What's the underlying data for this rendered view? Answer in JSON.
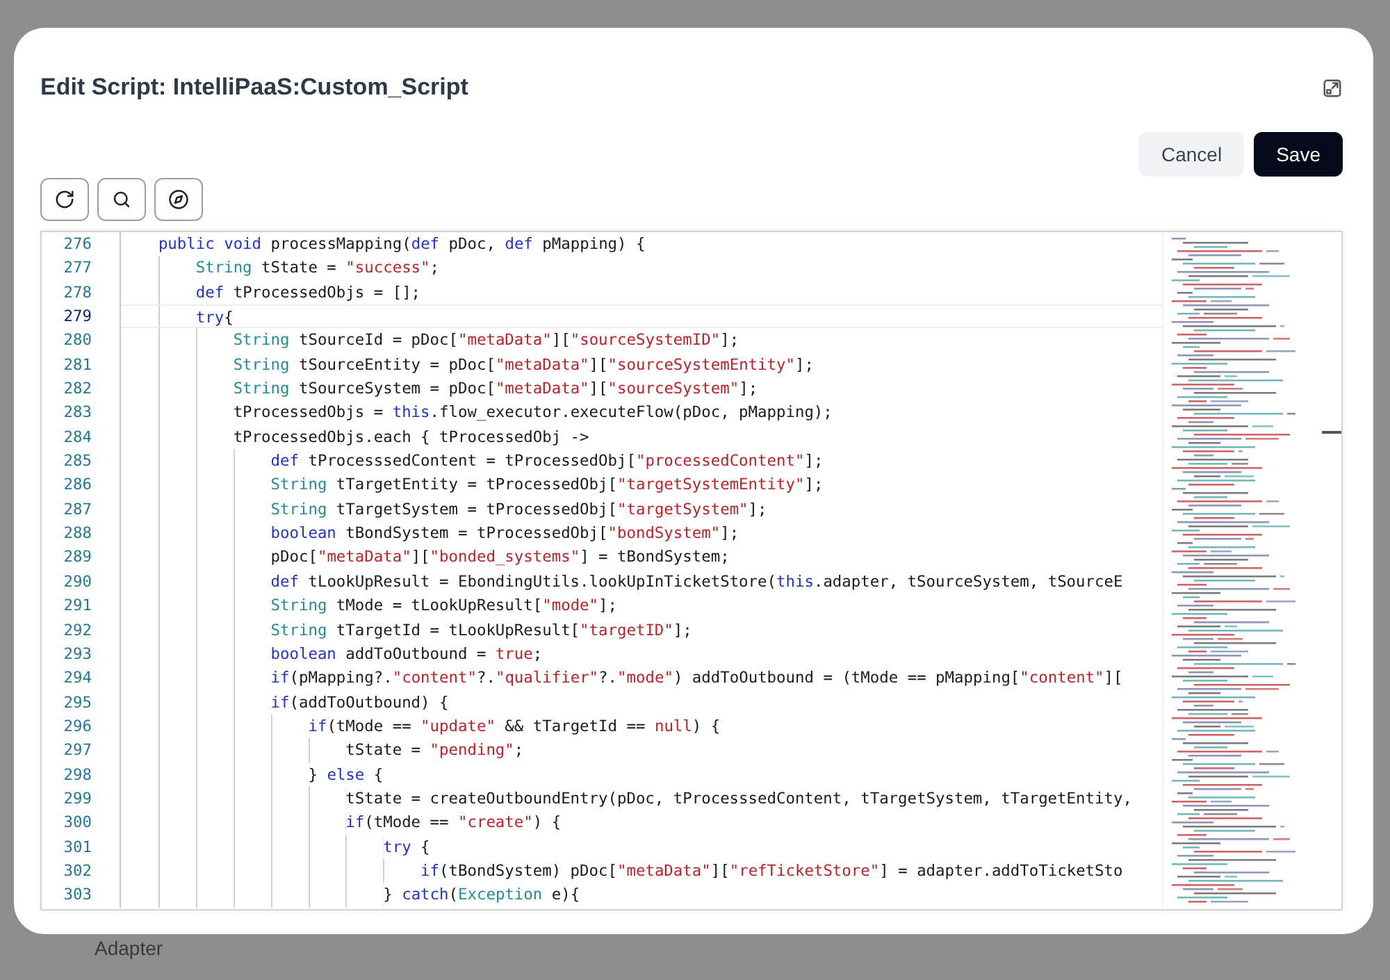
{
  "background": {
    "label": "Adapter"
  },
  "dialog": {
    "title": "Edit Script: IntelliPaaS:Custom_Script",
    "actions": [
      {
        "label": "Cancel",
        "kind": "secondary"
      },
      {
        "label": "Save",
        "kind": "primary"
      }
    ],
    "tools": [
      {
        "kind": "refresh"
      },
      {
        "kind": "search"
      },
      {
        "kind": "compass"
      }
    ],
    "editor": {
      "lines": [
        {
          "number": "276",
          "current": false,
          "segments": [
            {
              "kind": "keyword",
              "text": "    public void"
            },
            {
              "kind": "plain",
              "text": " processMapping("
            },
            {
              "kind": "keyword",
              "text": "def"
            },
            {
              "kind": "plain",
              "text": " pDoc, "
            },
            {
              "kind": "keyword",
              "text": "def"
            },
            {
              "kind": "plain",
              "text": " pMapping) {"
            }
          ]
        },
        {
          "number": "277",
          "current": false,
          "segments": [
            {
              "kind": "type",
              "text": "        String"
            },
            {
              "kind": "plain",
              "text": " tState = "
            },
            {
              "kind": "string",
              "text": "\"success\""
            },
            {
              "kind": "plain",
              "text": ";"
            }
          ]
        },
        {
          "number": "278",
          "current": false,
          "segments": [
            {
              "kind": "keyword",
              "text": "        def"
            },
            {
              "kind": "plain",
              "text": " tProcessedObjs = [];"
            }
          ]
        },
        {
          "number": "279",
          "current": true,
          "segments": [
            {
              "kind": "keyword",
              "text": "        try"
            },
            {
              "kind": "plain",
              "text": "{"
            }
          ]
        },
        {
          "number": "280",
          "current": false,
          "segments": [
            {
              "kind": "type",
              "text": "            String"
            },
            {
              "kind": "plain",
              "text": " tSourceId = pDoc["
            },
            {
              "kind": "string",
              "text": "\"metaData\""
            },
            {
              "kind": "plain",
              "text": "]["
            },
            {
              "kind": "string",
              "text": "\"sourceSystemID\""
            },
            {
              "kind": "plain",
              "text": "];"
            }
          ]
        },
        {
          "number": "281",
          "current": false,
          "segments": [
            {
              "kind": "type",
              "text": "            String"
            },
            {
              "kind": "plain",
              "text": " tSourceEntity = pDoc["
            },
            {
              "kind": "string",
              "text": "\"metaData\""
            },
            {
              "kind": "plain",
              "text": "]["
            },
            {
              "kind": "string",
              "text": "\"sourceSystemEntity\""
            },
            {
              "kind": "plain",
              "text": "];"
            }
          ]
        },
        {
          "number": "282",
          "current": false,
          "segments": [
            {
              "kind": "type",
              "text": "            String"
            },
            {
              "kind": "plain",
              "text": " tSourceSystem = pDoc["
            },
            {
              "kind": "string",
              "text": "\"metaData\""
            },
            {
              "kind": "plain",
              "text": "]["
            },
            {
              "kind": "string",
              "text": "\"sourceSystem\""
            },
            {
              "kind": "plain",
              "text": "];"
            }
          ]
        },
        {
          "number": "283",
          "current": false,
          "segments": [
            {
              "kind": "plain",
              "text": "            tProcessedObjs = "
            },
            {
              "kind": "keyword",
              "text": "this"
            },
            {
              "kind": "plain",
              "text": ".flow_executor.executeFlow(pDoc, pMapping);"
            }
          ]
        },
        {
          "number": "284",
          "current": false,
          "segments": [
            {
              "kind": "plain",
              "text": "            tProcessedObjs.each { tProcessedObj ->"
            }
          ]
        },
        {
          "number": "285",
          "current": false,
          "segments": [
            {
              "kind": "keyword",
              "text": "                def"
            },
            {
              "kind": "plain",
              "text": " tProcesssedContent = tProcessedObj["
            },
            {
              "kind": "string",
              "text": "\"processedContent\""
            },
            {
              "kind": "plain",
              "text": "];"
            }
          ]
        },
        {
          "number": "286",
          "current": false,
          "segments": [
            {
              "kind": "type",
              "text": "                String"
            },
            {
              "kind": "plain",
              "text": " tTargetEntity = tProcessedObj["
            },
            {
              "kind": "string",
              "text": "\"targetSystemEntity\""
            },
            {
              "kind": "plain",
              "text": "];"
            }
          ]
        },
        {
          "number": "287",
          "current": false,
          "segments": [
            {
              "kind": "type",
              "text": "                String"
            },
            {
              "kind": "plain",
              "text": " tTargetSystem = tProcessedObj["
            },
            {
              "kind": "string",
              "text": "\"targetSystem\""
            },
            {
              "kind": "plain",
              "text": "];"
            }
          ]
        },
        {
          "number": "288",
          "current": false,
          "segments": [
            {
              "kind": "keyword",
              "text": "                boolean"
            },
            {
              "kind": "plain",
              "text": " tBondSystem = tProcessedObj["
            },
            {
              "kind": "string",
              "text": "\"bondSystem\""
            },
            {
              "kind": "plain",
              "text": "];"
            }
          ]
        },
        {
          "number": "289",
          "current": false,
          "segments": [
            {
              "kind": "plain",
              "text": "                pDoc["
            },
            {
              "kind": "string",
              "text": "\"metaData\""
            },
            {
              "kind": "plain",
              "text": "]["
            },
            {
              "kind": "string",
              "text": "\"bonded_systems\""
            },
            {
              "kind": "plain",
              "text": "] = tBondSystem;"
            }
          ]
        },
        {
          "number": "290",
          "current": false,
          "segments": [
            {
              "kind": "keyword",
              "text": "                def"
            },
            {
              "kind": "plain",
              "text": " tLookUpResult = EbondingUtils.lookUpInTicketStore("
            },
            {
              "kind": "keyword",
              "text": "this"
            },
            {
              "kind": "plain",
              "text": ".adapter, tSourceSystem, tSourceE"
            }
          ]
        },
        {
          "number": "291",
          "current": false,
          "segments": [
            {
              "kind": "type",
              "text": "                String"
            },
            {
              "kind": "plain",
              "text": " tMode = tLookUpResult["
            },
            {
              "kind": "string",
              "text": "\"mode\""
            },
            {
              "kind": "plain",
              "text": "];"
            }
          ]
        },
        {
          "number": "292",
          "current": false,
          "segments": [
            {
              "kind": "type",
              "text": "                String"
            },
            {
              "kind": "plain",
              "text": " tTargetId = tLookUpResult["
            },
            {
              "kind": "string",
              "text": "\"targetID\""
            },
            {
              "kind": "plain",
              "text": "];"
            }
          ]
        },
        {
          "number": "293",
          "current": false,
          "segments": [
            {
              "kind": "keyword",
              "text": "                boolean"
            },
            {
              "kind": "plain",
              "text": " addToOutbound = "
            },
            {
              "kind": "string",
              "text": "true"
            },
            {
              "kind": "plain",
              "text": ";"
            }
          ]
        },
        {
          "number": "294",
          "current": false,
          "segments": [
            {
              "kind": "keyword",
              "text": "                if"
            },
            {
              "kind": "plain",
              "text": "(pMapping?."
            },
            {
              "kind": "string",
              "text": "\"content\""
            },
            {
              "kind": "plain",
              "text": "?."
            },
            {
              "kind": "string",
              "text": "\"qualifier\""
            },
            {
              "kind": "plain",
              "text": "?."
            },
            {
              "kind": "string",
              "text": "\"mode\""
            },
            {
              "kind": "plain",
              "text": ") addToOutbound = (tMode == pMapping["
            },
            {
              "kind": "string",
              "text": "\"content\""
            },
            {
              "kind": "plain",
              "text": "]["
            }
          ]
        },
        {
          "number": "295",
          "current": false,
          "segments": [
            {
              "kind": "keyword",
              "text": "                if"
            },
            {
              "kind": "plain",
              "text": "(addToOutbound) {"
            }
          ]
        },
        {
          "number": "296",
          "current": false,
          "segments": [
            {
              "kind": "keyword",
              "text": "                    if"
            },
            {
              "kind": "plain",
              "text": "(tMode == "
            },
            {
              "kind": "string",
              "text": "\"update\""
            },
            {
              "kind": "plain",
              "text": " && tTargetId == "
            },
            {
              "kind": "string",
              "text": "null"
            },
            {
              "kind": "plain",
              "text": ") {"
            }
          ]
        },
        {
          "number": "297",
          "current": false,
          "segments": [
            {
              "kind": "plain",
              "text": "                        tState = "
            },
            {
              "kind": "string",
              "text": "\"pending\""
            },
            {
              "kind": "plain",
              "text": ";"
            }
          ]
        },
        {
          "number": "298",
          "current": false,
          "segments": [
            {
              "kind": "plain",
              "text": "                    } "
            },
            {
              "kind": "keyword",
              "text": "else"
            },
            {
              "kind": "plain",
              "text": " {"
            }
          ]
        },
        {
          "number": "299",
          "current": false,
          "segments": [
            {
              "kind": "plain",
              "text": "                        tState = createOutboundEntry(pDoc, tProcesssedContent, tTargetSystem, tTargetEntity,"
            }
          ]
        },
        {
          "number": "300",
          "current": false,
          "segments": [
            {
              "kind": "keyword",
              "text": "                        if"
            },
            {
              "kind": "plain",
              "text": "(tMode == "
            },
            {
              "kind": "string",
              "text": "\"create\""
            },
            {
              "kind": "plain",
              "text": ") {"
            }
          ]
        },
        {
          "number": "301",
          "current": false,
          "segments": [
            {
              "kind": "keyword",
              "text": "                            try"
            },
            {
              "kind": "plain",
              "text": " {"
            }
          ]
        },
        {
          "number": "302",
          "current": false,
          "segments": [
            {
              "kind": "keyword",
              "text": "                                if"
            },
            {
              "kind": "plain",
              "text": "(tBondSystem) pDoc["
            },
            {
              "kind": "string",
              "text": "\"metaData\""
            },
            {
              "kind": "plain",
              "text": "]["
            },
            {
              "kind": "string",
              "text": "\"refTicketStore\""
            },
            {
              "kind": "plain",
              "text": "] = adapter.addToTicketSto"
            }
          ]
        },
        {
          "number": "303",
          "current": false,
          "segments": [
            {
              "kind": "plain",
              "text": "                            } "
            },
            {
              "kind": "keyword",
              "text": "catch"
            },
            {
              "kind": "plain",
              "text": "("
            },
            {
              "kind": "type",
              "text": "Exception"
            },
            {
              "kind": "plain",
              "text": " e){"
            }
          ]
        }
      ]
    }
  }
}
